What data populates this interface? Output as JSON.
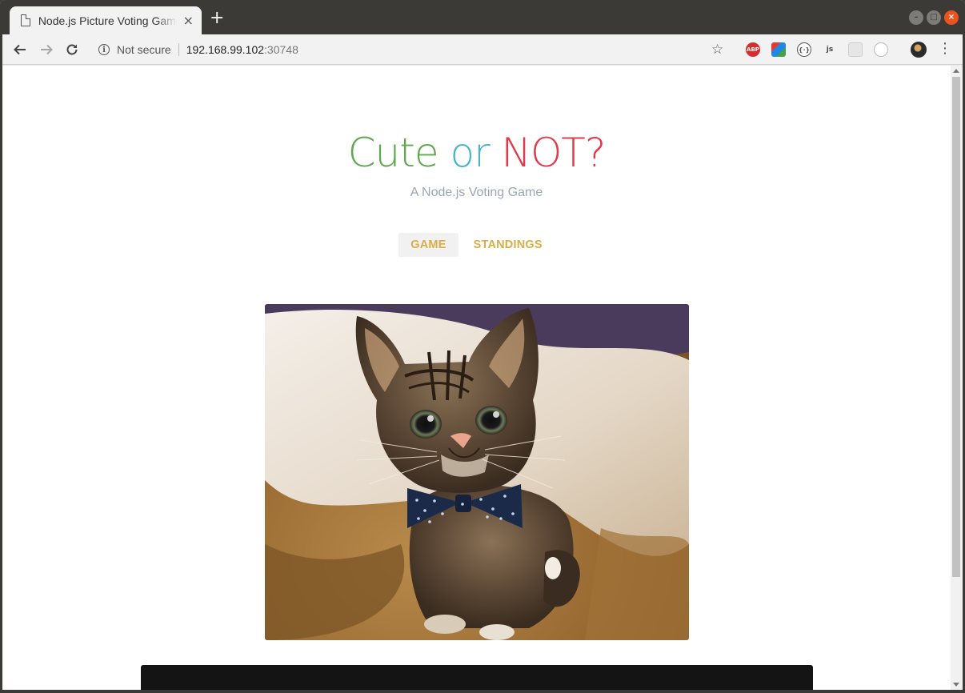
{
  "browser": {
    "tab_title": "Node.js Picture Voting Game",
    "tab_close": "×",
    "new_tab": "+",
    "security_label": "Not secure",
    "url_host": "192.168.99.102",
    "url_port": ":30748",
    "extensions": [
      "adblock-icon",
      "color-picker-icon",
      "json-viewer-icon",
      "js-icon",
      "extension-icon",
      "extension-icon"
    ],
    "abp_label": "ABP",
    "js_label": "js"
  },
  "page": {
    "title_words": {
      "cute": "Cute",
      "or": "or",
      "not": "NOT?"
    },
    "subtitle": "A Node.js Voting Game",
    "nav": {
      "game": "GAME",
      "standings": "STANDINGS"
    },
    "photo": {
      "subject": "kitten-with-bowtie"
    }
  },
  "colors": {
    "cute": "#5fa84f",
    "or": "#4ab4cc",
    "not": "#e03a4b",
    "nav_accent": "#d8ae4a",
    "subtitle": "#9aa6b8"
  }
}
